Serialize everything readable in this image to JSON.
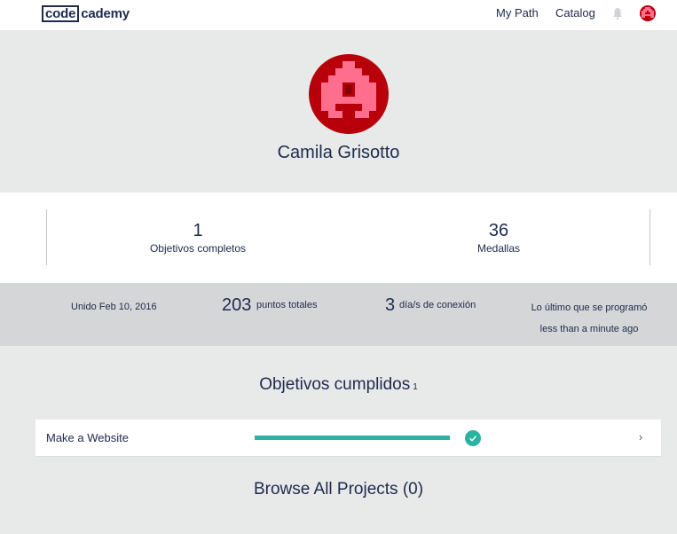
{
  "nav": {
    "logo_code": "code",
    "logo_rest": "cademy",
    "my_path": "My Path",
    "catalog": "Catalog",
    "bell_icon": "bell-icon",
    "avatar_icon": "user-avatar-icon"
  },
  "profile": {
    "name": "Camila Grisotto",
    "avatar_colors": {
      "background": "#b8000a",
      "pattern": "#ff6e8c"
    }
  },
  "stats": {
    "goals_done": {
      "value": "1",
      "label": "Objetivos completos"
    },
    "badges": {
      "value": "36",
      "label": "Medallas"
    }
  },
  "info": {
    "joined": "Unido Feb 10, 2016",
    "points_value": "203",
    "points_label": "puntos totales",
    "days_value": "3",
    "days_label": "día/s de conexión",
    "last_coded": "Lo último que se programó less than a minute ago"
  },
  "goals": {
    "title": "Objetivos cumplidos",
    "count": "1",
    "items": [
      {
        "name": "Make a Website",
        "progress": 1.0,
        "completed": true
      }
    ]
  },
  "browse": {
    "label": "Browse All Projects (0)"
  },
  "colors": {
    "accent": "#2ab3a0",
    "text": "#1f2a4d",
    "background": "#e8e9e9",
    "infobar": "#d5d6d7"
  }
}
